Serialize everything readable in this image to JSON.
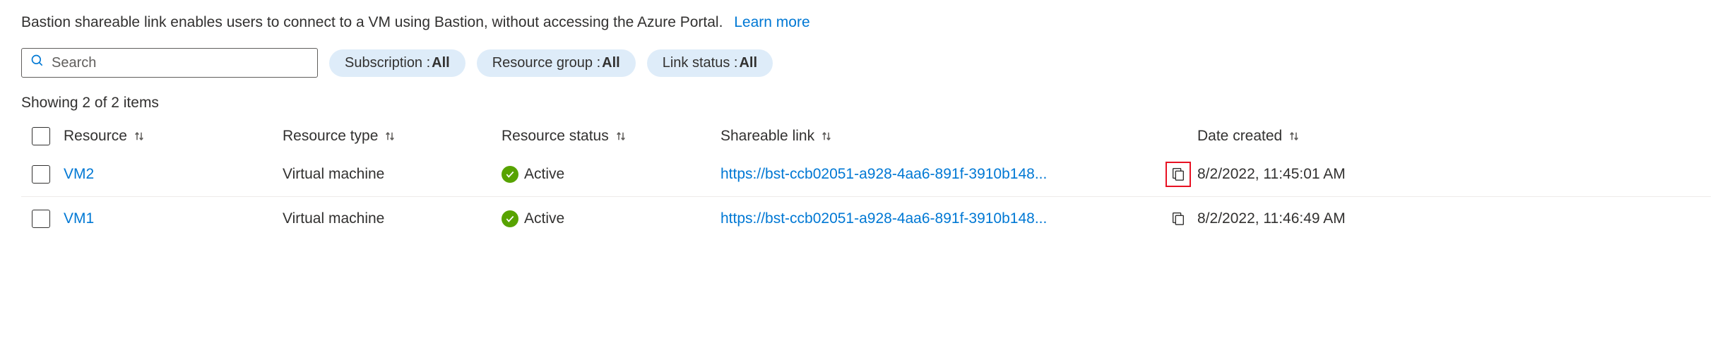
{
  "description": "Bastion shareable link enables users to connect to a VM using Bastion, without accessing the Azure Portal.",
  "learn_more": "Learn more",
  "search": {
    "placeholder": "Search"
  },
  "filters": [
    {
      "label": "Subscription : ",
      "value": "All"
    },
    {
      "label": "Resource group : ",
      "value": "All"
    },
    {
      "label": "Link status : ",
      "value": "All"
    }
  ],
  "count_text": "Showing 2 of 2 items",
  "columns": {
    "resource": "Resource",
    "resource_type": "Resource type",
    "resource_status": "Resource status",
    "shareable_link": "Shareable link",
    "date_created": "Date created"
  },
  "rows": [
    {
      "resource": "VM2",
      "type": "Virtual machine",
      "status": "Active",
      "link": "https://bst-ccb02051-a928-4aa6-891f-3910b148...",
      "date": "8/2/2022, 11:45:01 AM",
      "highlighted_copy": true
    },
    {
      "resource": "VM1",
      "type": "Virtual machine",
      "status": "Active",
      "link": "https://bst-ccb02051-a928-4aa6-891f-3910b148...",
      "date": "8/2/2022, 11:46:49 AM",
      "highlighted_copy": false
    }
  ]
}
